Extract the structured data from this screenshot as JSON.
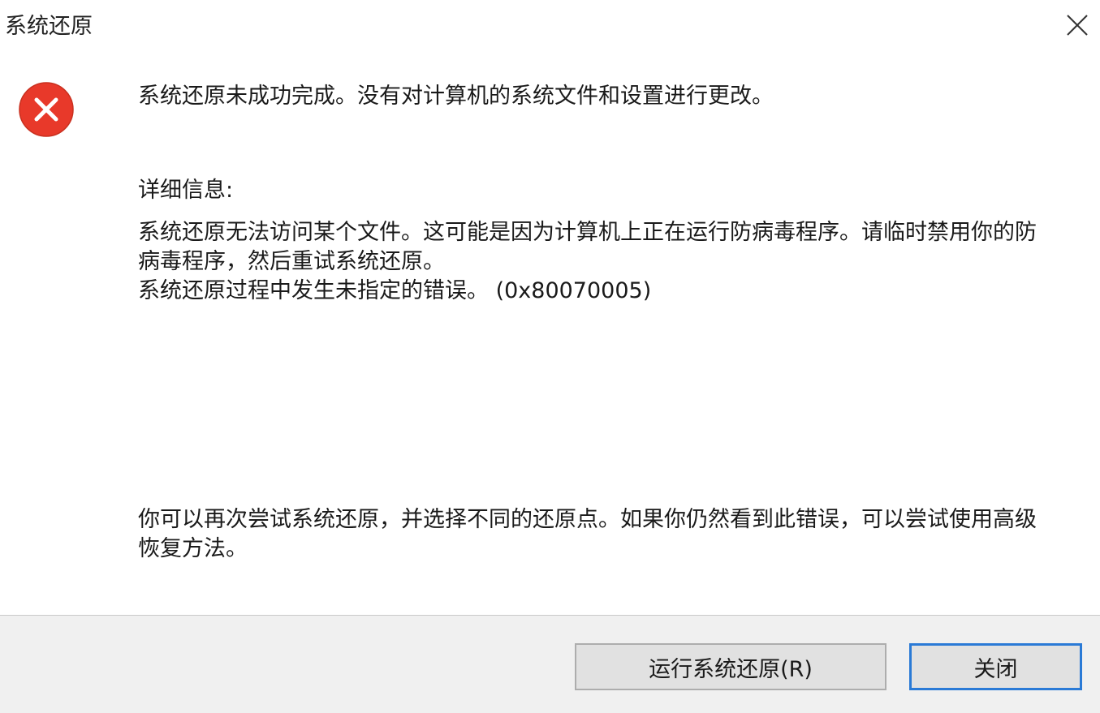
{
  "window": {
    "title": "系统还原"
  },
  "icons": {
    "error": "error-icon",
    "close": "close-icon",
    "error_color": "#e8392a"
  },
  "message": {
    "main": "系统还原未成功完成。没有对计算机的系统文件和设置进行更改。",
    "details_label": "详细信息:",
    "details_lines": [
      "系统还原无法访问某个文件。这可能是因为计算机上正在运行防病毒程序。请临时禁用你的防",
      "病毒程序，然后重试系统还原。",
      "系统还原过程中发生未指定的错误。 (0x80070005)"
    ],
    "hint_lines": [
      "你可以再次尝试系统还原，并选择不同的还原点。如果你仍然看到此错误，可以尝试使用高级",
      "恢复方法。"
    ]
  },
  "buttons": {
    "run_restore": "运行系统还原(R)",
    "close": "关闭"
  },
  "colors": {
    "footer_bg": "#f0f0f0",
    "default_button_border": "#2a7ad6"
  }
}
